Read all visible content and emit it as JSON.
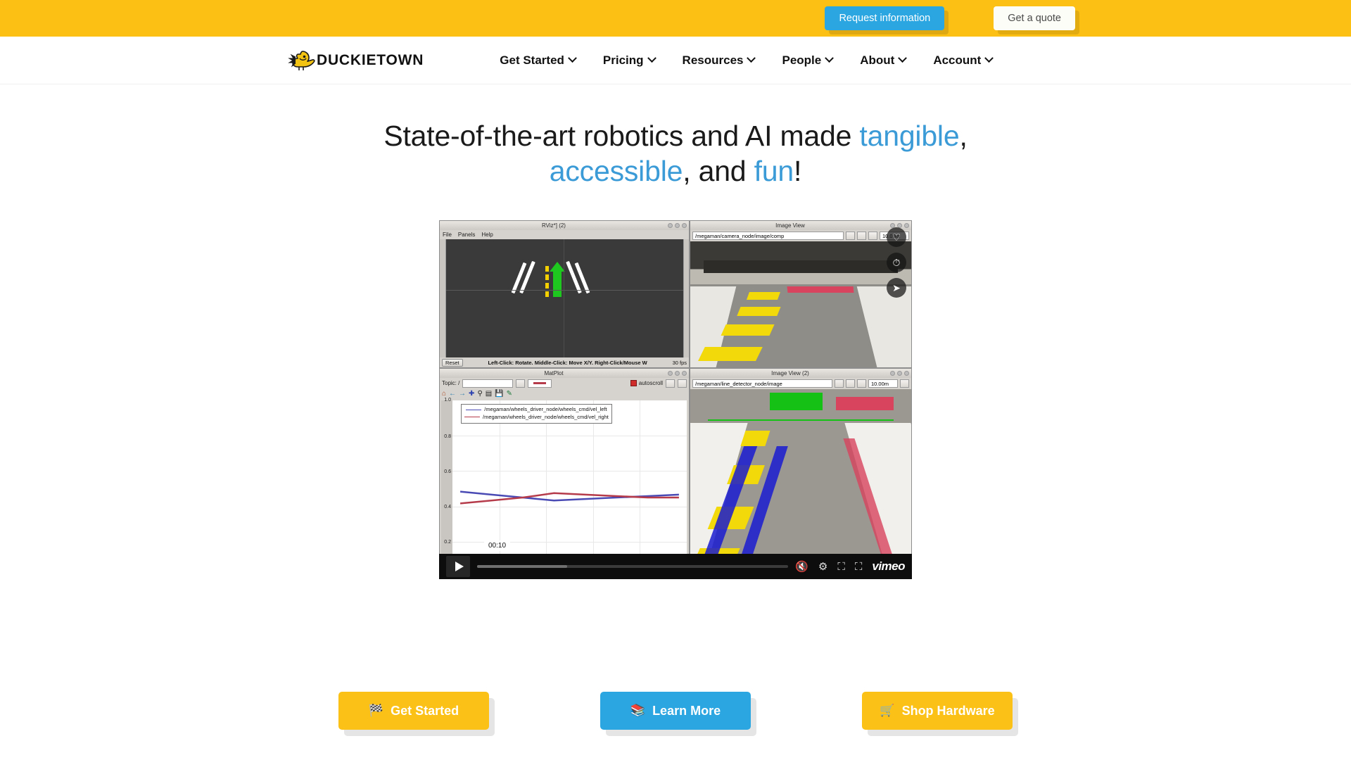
{
  "colors": {
    "brand_yellow": "#fcc014",
    "brand_blue": "#2ba6e0",
    "headline_blue": "#3b9bd6",
    "text_dark": "#111111"
  },
  "topbar": {
    "request_information_label": "Request information",
    "get_a_quote_label": "Get a quote"
  },
  "header": {
    "logo_text": "DUCKIETOWN",
    "logo_icon": "duck-icon",
    "nav": [
      {
        "label": "Get Started",
        "icon": "chevron-down-icon"
      },
      {
        "label": "Pricing",
        "icon": "chevron-down-icon"
      },
      {
        "label": "Resources",
        "icon": "chevron-down-icon"
      },
      {
        "label": "People",
        "icon": "chevron-down-icon"
      },
      {
        "label": "About",
        "icon": "chevron-down-icon"
      },
      {
        "label": "Account",
        "icon": "chevron-down-icon"
      }
    ]
  },
  "hero": {
    "headline_part1": "State-of-the-art robotics and AI made ",
    "headline_hl1": "tangible",
    "headline_part2": ", ",
    "headline_hl2": "accessible",
    "headline_part3": ", and ",
    "headline_hl3": "fun",
    "headline_part4": "!"
  },
  "video": {
    "current_time": "00:10",
    "provider_logo": "vimeo",
    "play_icon": "play-icon",
    "volume_icon": "volume-muted-icon",
    "settings_icon": "gear-icon",
    "pip_icon": "picture-in-picture-icon",
    "fullscreen_icon": "fullscreen-icon",
    "like_icon": "heart-icon",
    "watchlater_icon": "clock-icon",
    "share_icon": "share-icon",
    "panels": {
      "rviz": {
        "title": "RViz*] (2)",
        "menus": [
          "File",
          "Panels",
          "Help"
        ],
        "reset_label": "Reset",
        "status_hint": "Left-Click: Rotate.  Middle-Click: Move X/Y.  Right-Click/Mouse W",
        "fps": "30 fps"
      },
      "image_view_1": {
        "title": "Image View",
        "topic": "/megaman/camera_node/image/comp",
        "rate": "10.00m"
      },
      "image_view_2": {
        "title": "Image View (2)",
        "topic": "/megaman/line_detector_node/image",
        "rate": "10.00m"
      },
      "matplot": {
        "title": "MatPlot",
        "topic_label": "Topic: /",
        "autoscroll_label": "autoscroll",
        "legend": [
          "/megaman/wheels_driver_node/wheels_cmd/vel_left",
          "/megaman/wheels_driver_node/wheels_cmd/vel_right"
        ],
        "y_ticks": [
          "1.0",
          "0.8",
          "0.6",
          "0.4",
          "0.2"
        ]
      }
    }
  },
  "ctas": [
    {
      "emoji": "🏁",
      "icon": "checkered-flag-icon",
      "label": "Get Started",
      "style": "yellow"
    },
    {
      "emoji": "📚",
      "icon": "books-icon",
      "label": "Learn More",
      "style": "blue"
    },
    {
      "emoji": "🛒",
      "icon": "shopping-cart-icon",
      "label": "Shop Hardware",
      "style": "yellow"
    }
  ]
}
